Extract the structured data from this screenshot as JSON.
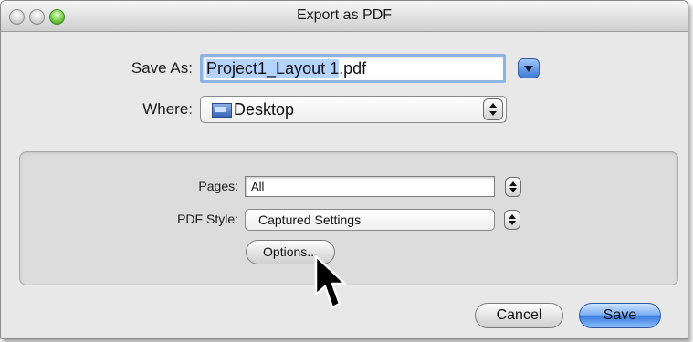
{
  "window": {
    "title": "Export as PDF"
  },
  "save_as": {
    "label": "Save As:",
    "filename_selected": "Project1_Layout 1",
    "filename_ext": ".pdf"
  },
  "where": {
    "label": "Where:",
    "value": "Desktop",
    "icon": "folder-icon"
  },
  "pages": {
    "label": "Pages:",
    "value": "All"
  },
  "pdf_style": {
    "label": "PDF Style:",
    "value": "Captured Settings"
  },
  "buttons": {
    "options": "Options...",
    "cancel": "Cancel",
    "save": "Save"
  },
  "colors": {
    "accent_blue": "#3d7ee0",
    "focus_ring": "#8db3e4",
    "selection": "#b5d3ff"
  }
}
